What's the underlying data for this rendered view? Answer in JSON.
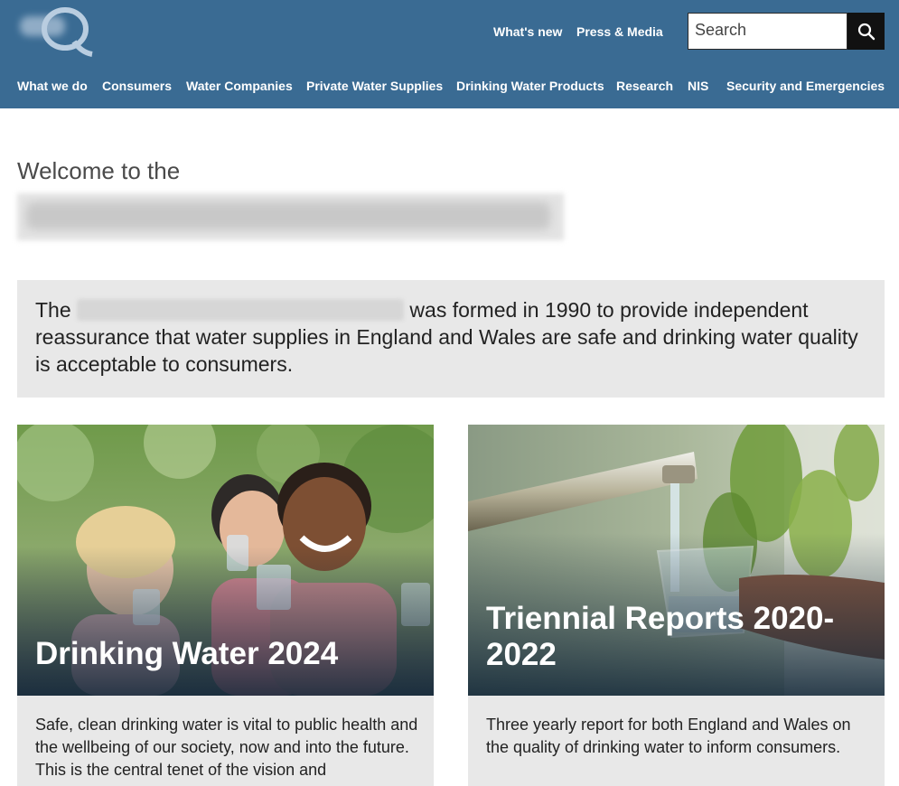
{
  "header": {
    "utility_links": [
      "What's new",
      "Press & Media"
    ],
    "search_placeholder": "Search",
    "nav": [
      "What we do",
      "Consumers",
      "Water Companies",
      "Private Water Supplies",
      "Drinking Water Products",
      "Research",
      "NIS",
      "Security and Emergencies"
    ]
  },
  "main": {
    "welcome": "Welcome to the",
    "intro": {
      "prefix": "The",
      "suffix": "was formed in 1990 to provide independent reassurance that water supplies in England and Wales are safe and drinking water quality is acceptable to consumers."
    },
    "cards": [
      {
        "title": "Drinking Water 2024",
        "description": "Safe, clean drinking water is vital to public health and the wellbeing of our society, now and into the future. This is the central tenet of the vision and"
      },
      {
        "title": "Triennial Reports 2020-2022",
        "description": "Three yearly report for both England and Wales on the quality of drinking water to inform consumers."
      }
    ]
  },
  "colors": {
    "header": "#3a6b93",
    "panel": "#e8e8e8",
    "search_button": "#111111"
  }
}
